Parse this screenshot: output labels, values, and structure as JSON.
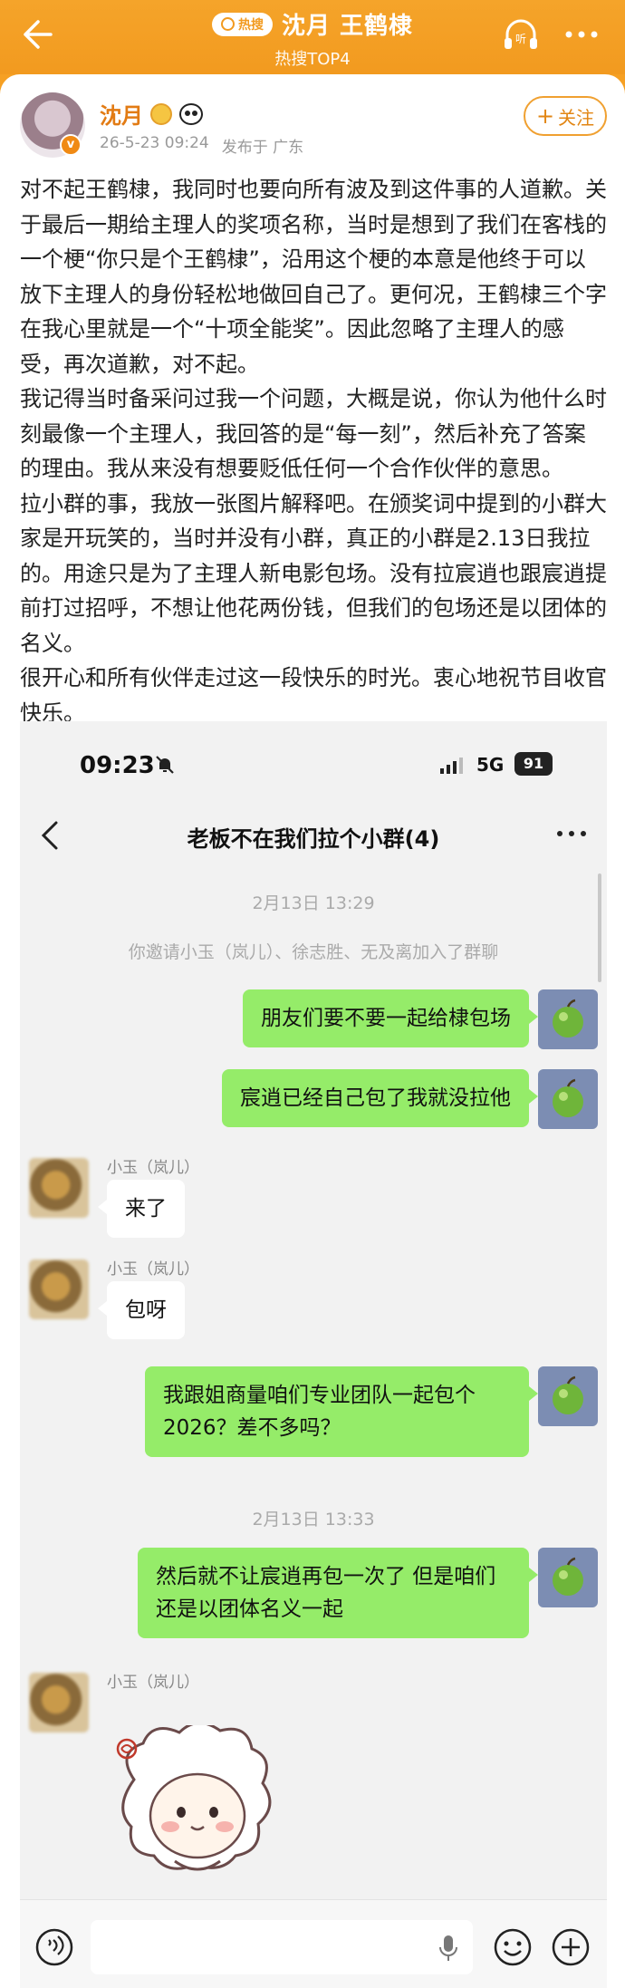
{
  "header": {
    "hot_badge": "热搜",
    "title": "沈月 王鹤棣",
    "subtitle": "热搜TOP4"
  },
  "author": {
    "name": "沈月",
    "date": "26-5-23 09:24",
    "location": "发布于 广东",
    "follow_label": "关注"
  },
  "post": {
    "paragraphs": [
      "对不起王鹤棣，我同时也要向所有波及到这件事的人道歉。关于最后一期给主理人的奖项名称，当时是想到了我们在客栈的一个梗“你只是个王鹤棣”，沿用这个梗的本意是他终于可以放下主理人的身份轻松地做回自己了。更何况，王鹤棣三个字在我心里就是一个“十项全能奖”。因此忽略了主理人的感受，再次道歉，对不起。",
      "我记得当时备采问过我一个问题，大概是说，你认为他什么时刻最像一个主理人，我回答的是“每一刻”，然后补充了答案的理由。我从来没有想要贬低任何一个合作伙伴的意思。",
      "拉小群的事，我放一张图片解释吧。在颁奖词中提到的小群大家是开玩笑的，当时并没有小群，真正的小群是2.13日我拉的。用途只是为了主理人新电影包场。没有拉宸逍也跟宸逍提前打过招呼，不想让他花两份钱，但我们的包场还是以团体的名义。",
      "很开心和所有伙伴走过这一段快乐的时光。衷心地祝节目收官快乐。"
    ]
  },
  "screenshot": {
    "status": {
      "time": "09:23",
      "network": "5G",
      "battery": "91"
    },
    "chat_title": "老板不在我们拉个小群(4)",
    "timestamps": [
      "2月13日 13:29",
      "2月13日 13:33"
    ],
    "system_msg": "你邀请小玉（岚儿）、徐志胜、无及离加入了群聊",
    "sender_name": "小玉（岚儿）",
    "messages": [
      {
        "from": "me",
        "text": "朋友们要不要一起给棣包场"
      },
      {
        "from": "me",
        "text": "宸逍已经自己包了我就没拉他"
      },
      {
        "from": "other",
        "text": "来了"
      },
      {
        "from": "other",
        "text": "包呀"
      },
      {
        "from": "me",
        "text": "我跟姐商量咱们专业团队一起包个2026？差不多吗？"
      },
      {
        "from": "me",
        "text": "然后就不让宸逍再包一次了 但是咱们还是以团体名义一起"
      }
    ]
  },
  "colors": {
    "accent": "#f29a1f",
    "bubble_me": "#95ec69",
    "name_orange": "#e27b14"
  }
}
